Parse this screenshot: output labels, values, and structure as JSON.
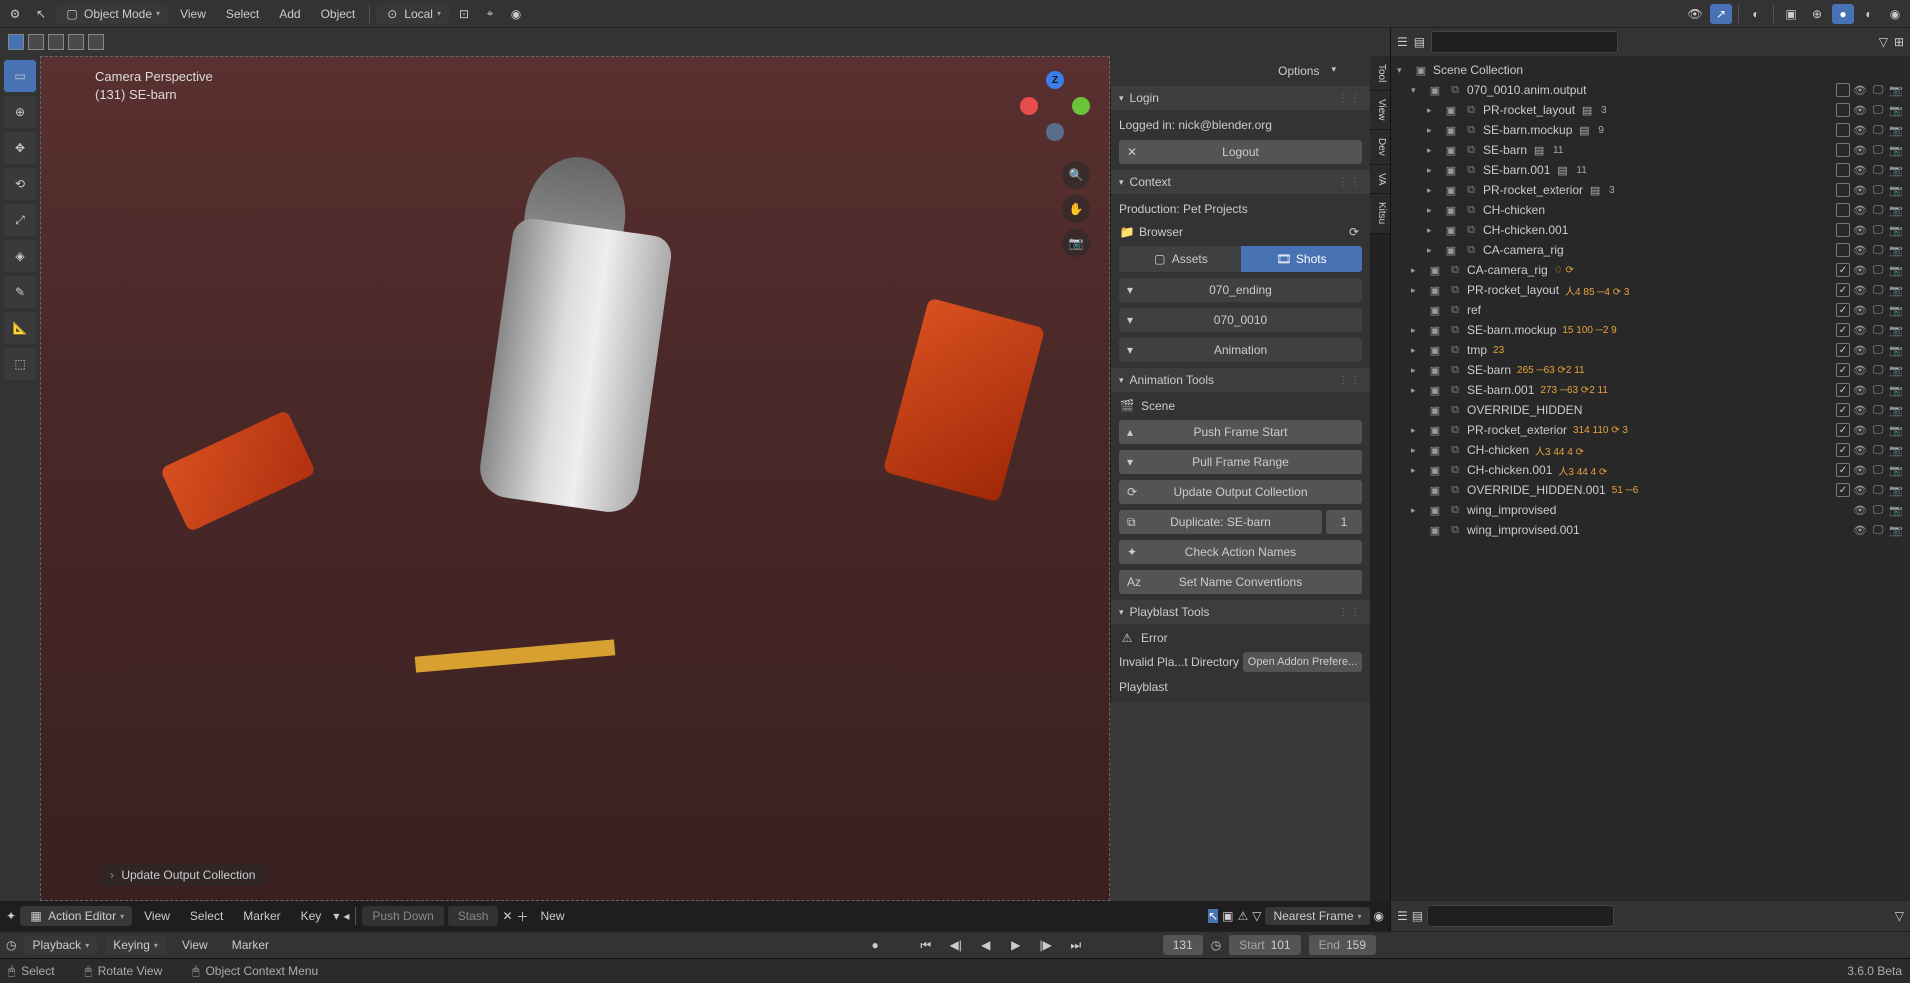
{
  "topbar": {
    "mode_label": "Object Mode",
    "orient_label": "Local",
    "menus": {
      "view": "View",
      "select": "Select",
      "add": "Add",
      "object": "Object"
    }
  },
  "viewport": {
    "perspective": "Camera Perspective",
    "object_name": "(131) SE-barn",
    "op_label": "Update Output Collection",
    "options_label": "Options"
  },
  "vert_tabs": [
    "Tool",
    "View",
    "Dev",
    "VA",
    "Kitsu"
  ],
  "login": {
    "header": "Login",
    "status": "Logged in: nick@blender.org",
    "logout": "Logout"
  },
  "context": {
    "header": "Context",
    "production": "Production: Pet Projects",
    "browser": "Browser",
    "assets": "Assets",
    "shots": "Shots",
    "seq": "070_ending",
    "shot": "070_0010",
    "task": "Animation"
  },
  "anim_tools": {
    "header": "Animation Tools",
    "scene": "Scene",
    "push": "Push Frame Start",
    "pull": "Pull Frame Range",
    "update": "Update Output Collection",
    "dup": "Duplicate: SE-barn",
    "dup_count": "1",
    "check": "Check Action Names",
    "setname": "Set Name Conventions"
  },
  "playblast": {
    "header": "Playblast Tools",
    "error": "Error",
    "error_msg": "Invalid Pla...t Directory",
    "open_prefs": "Open Addon Prefere...",
    "playblast": "Playblast"
  },
  "outliner": {
    "root": "Scene Collection",
    "rows": [
      {
        "depth": 1,
        "disc": "▾",
        "type": "coll",
        "name": "070_0010.anim.output",
        "toggles": [
          "chk_off",
          "eye",
          "mon",
          "cam"
        ]
      },
      {
        "depth": 2,
        "disc": "▸",
        "type": "coll",
        "name": "PR-rocket_layout",
        "b": "3",
        "toggles": [
          "chk_off",
          "eye",
          "mon",
          "cam"
        ]
      },
      {
        "depth": 2,
        "disc": "▸",
        "type": "coll",
        "name": "SE-barn.mockup",
        "b": "9",
        "toggles": [
          "chk_off",
          "eye",
          "mon",
          "cam"
        ]
      },
      {
        "depth": 2,
        "disc": "▸",
        "type": "coll",
        "name": "SE-barn",
        "b": "11",
        "toggles": [
          "chk_off",
          "eye",
          "mon",
          "cam"
        ]
      },
      {
        "depth": 2,
        "disc": "▸",
        "type": "coll",
        "name": "SE-barn.001",
        "b": "11",
        "toggles": [
          "chk_off",
          "eye",
          "mon",
          "cam"
        ]
      },
      {
        "depth": 2,
        "disc": "▸",
        "type": "coll",
        "name": "PR-rocket_exterior",
        "b": "3",
        "toggles": [
          "chk_off",
          "eye",
          "mon",
          "cam"
        ]
      },
      {
        "depth": 2,
        "disc": "▸",
        "type": "coll",
        "name": "CH-chicken",
        "toggles": [
          "chk_off",
          "eye",
          "mon",
          "cam"
        ]
      },
      {
        "depth": 2,
        "disc": "▸",
        "type": "coll",
        "name": "CH-chicken.001",
        "toggles": [
          "chk_off",
          "eye",
          "mon",
          "cam"
        ]
      },
      {
        "depth": 2,
        "disc": "▸",
        "type": "coll",
        "name": "CA-camera_rig",
        "toggles": [
          "chk_off",
          "eye",
          "mon",
          "cam"
        ]
      },
      {
        "depth": 1,
        "disc": "▸",
        "type": "coll",
        "name": "CA-camera_rig",
        "meta": "♢ ⟳",
        "toggles": [
          "chk_on",
          "eye",
          "mon",
          "cam"
        ]
      },
      {
        "depth": 1,
        "disc": "▸",
        "type": "coll",
        "name": "PR-rocket_layout",
        "meta": "人4 85 ─4 ⟳ 3",
        "toggles": [
          "chk_on",
          "eye",
          "mon",
          "cam"
        ]
      },
      {
        "depth": 1,
        "disc": "",
        "type": "txt",
        "name": "ref",
        "toggles": [
          "chk_on",
          "eye",
          "mon",
          "cam"
        ]
      },
      {
        "depth": 1,
        "disc": "▸",
        "type": "coll",
        "name": "SE-barn.mockup",
        "meta": "15 100 ─2 9",
        "toggles": [
          "chk_on",
          "eye",
          "mon",
          "cam"
        ]
      },
      {
        "depth": 1,
        "disc": "▸",
        "type": "coll",
        "name": "tmp",
        "meta": "23",
        "toggles": [
          "chk_on",
          "eye",
          "mon",
          "cam"
        ]
      },
      {
        "depth": 1,
        "disc": "▸",
        "type": "coll",
        "name": "SE-barn",
        "meta": "265 ─63 ⟳2 11",
        "toggles": [
          "chk_on",
          "eye",
          "mon",
          "cam"
        ]
      },
      {
        "depth": 1,
        "disc": "▸",
        "type": "coll",
        "name": "SE-barn.001",
        "meta": "273 ─63 ⟳2 11",
        "toggles": [
          "chk_on",
          "eye",
          "mon",
          "cam"
        ]
      },
      {
        "depth": 1,
        "disc": "",
        "type": "coll",
        "name": "OVERRIDE_HIDDEN",
        "toggles": [
          "chk_on",
          "eye",
          "mon",
          "cam"
        ]
      },
      {
        "depth": 1,
        "disc": "▸",
        "type": "coll",
        "name": "PR-rocket_exterior",
        "meta": "314 110 ⟳ 3",
        "toggles": [
          "chk_on",
          "eye",
          "mon",
          "cam"
        ]
      },
      {
        "depth": 1,
        "disc": "▸",
        "type": "coll",
        "name": "CH-chicken",
        "meta": "人3 44 4 ⟳",
        "toggles": [
          "chk_on",
          "eye",
          "mon",
          "cam"
        ]
      },
      {
        "depth": 1,
        "disc": "▸",
        "type": "coll",
        "name": "CH-chicken.001",
        "meta": "人3 44 4 ⟳",
        "toggles": [
          "chk_on",
          "eye",
          "mon",
          "cam"
        ]
      },
      {
        "depth": 1,
        "disc": "",
        "type": "coll",
        "name": "OVERRIDE_HIDDEN.001",
        "meta": "51 ─6",
        "toggles": [
          "chk_on",
          "eye",
          "mon",
          "cam"
        ]
      },
      {
        "depth": 1,
        "disc": "▸",
        "type": "coll",
        "name": "wing_improvised",
        "toggles": [
          "eye",
          "mon",
          "cam"
        ]
      },
      {
        "depth": 1,
        "disc": "",
        "type": "coll",
        "name": "wing_improvised.001",
        "toggles": [
          "eye",
          "mon",
          "cam"
        ]
      }
    ]
  },
  "dope": {
    "editor_label": "Action Editor",
    "menus": {
      "view": "View",
      "select": "Select",
      "marker": "Marker",
      "key": "Key"
    },
    "push_down": "Push Down",
    "stash": "Stash",
    "new": "New",
    "snap": "Nearest Frame",
    "frame": "131",
    "start_label": "Start",
    "start": "101",
    "end_label": "End",
    "end": "159"
  },
  "timeline": {
    "playback": "Playback",
    "keying": "Keying",
    "view": "View",
    "marker": "Marker"
  },
  "status": {
    "select": "Select",
    "rotate": "Rotate View",
    "context_menu": "Object Context Menu",
    "version": "3.6.0 Beta"
  }
}
